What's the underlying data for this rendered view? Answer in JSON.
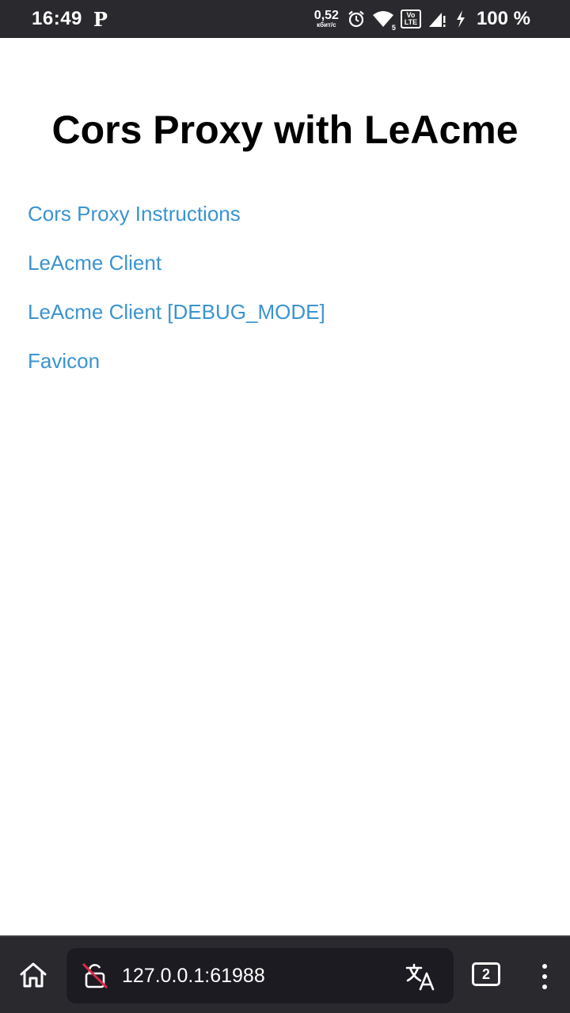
{
  "status_bar": {
    "time": "16:49",
    "p_indicator": "P",
    "net_speed_value": "0,52",
    "net_speed_unit": "кбит/с",
    "icons": [
      "alarm-icon",
      "wifi-icon",
      "volte-icon",
      "signal-icon",
      "charging-icon"
    ],
    "wifi_badge": "5",
    "volte_label_top": "Vo",
    "volte_label_bottom": "LTE",
    "battery": "100 %"
  },
  "page": {
    "title": "Cors Proxy with LeAcme",
    "links": [
      {
        "label": "Cors Proxy Instructions"
      },
      {
        "label": "LeAcme Client"
      },
      {
        "label": "LeAcme Client [DEBUG_MODE]"
      },
      {
        "label": "Favicon"
      }
    ],
    "link_color": "#3a94d0"
  },
  "browser_bar": {
    "url": "127.0.0.1:61988",
    "tab_count": "2",
    "icons": [
      "home-icon",
      "insecure-lock-icon",
      "translate-icon",
      "tabs-icon",
      "menu-icon"
    ]
  }
}
